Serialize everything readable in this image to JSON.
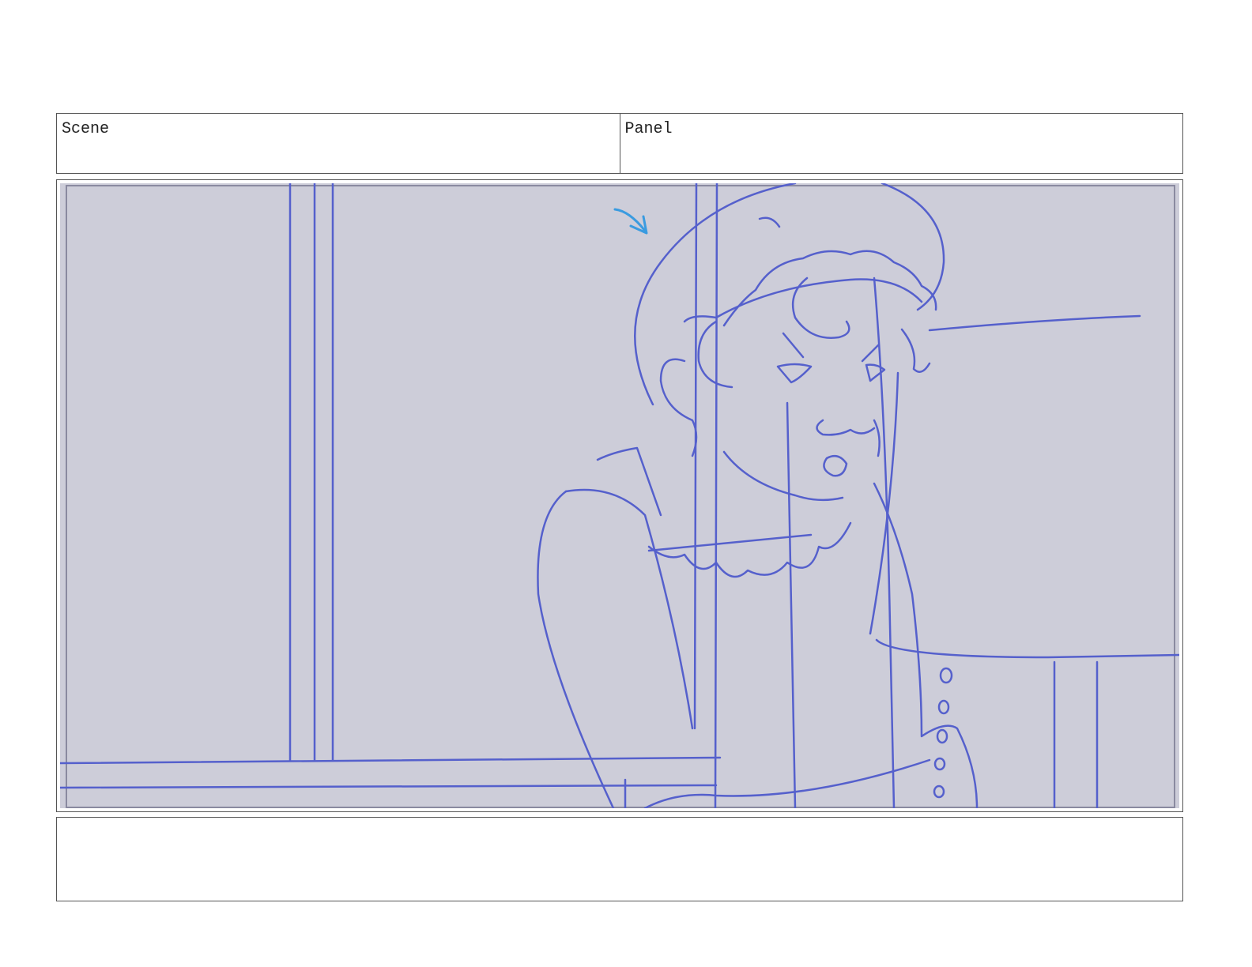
{
  "header": {
    "scene_label": "Scene",
    "panel_label": "Panel"
  },
  "colors": {
    "frame_background": "#cdcdd9",
    "sketch_line": "#5560cc",
    "arrow_accent": "#3a9be0"
  },
  "icons": {
    "direction_arrow": "arrow-down-right-icon"
  },
  "notes": {
    "text": ""
  }
}
